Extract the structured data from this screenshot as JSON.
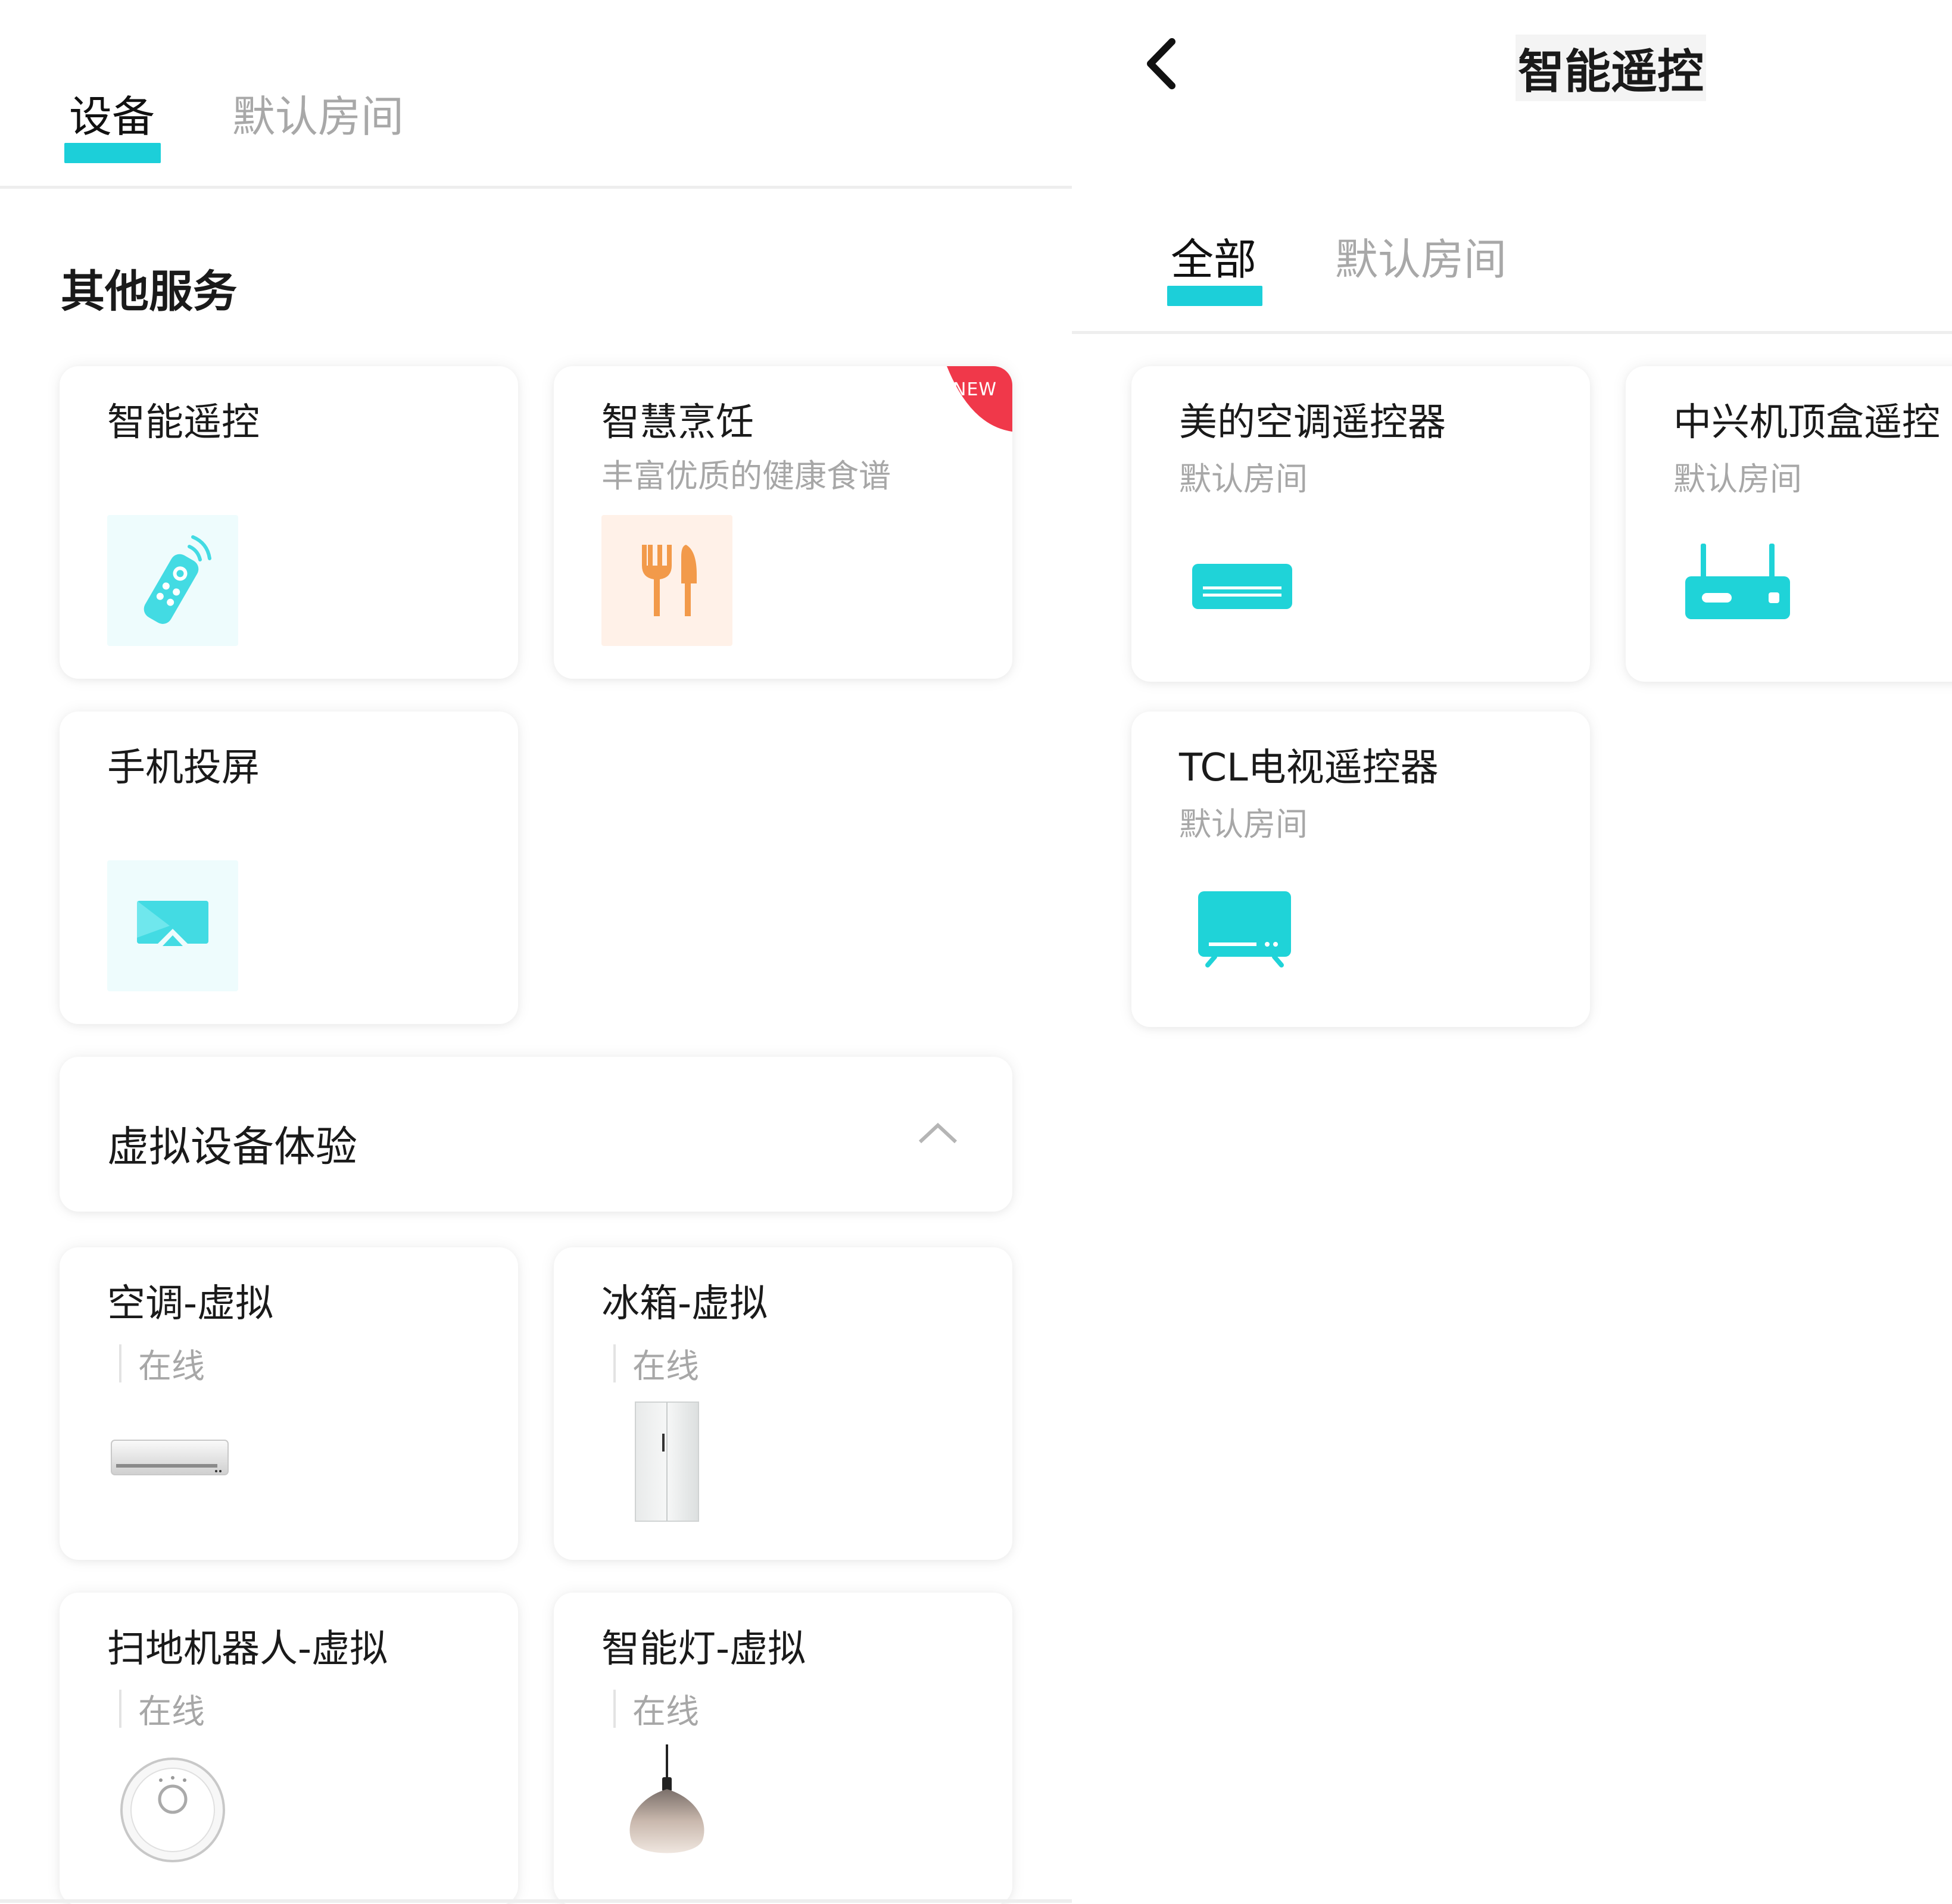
{
  "left": {
    "tabs": [
      {
        "label": "设备",
        "active": true
      },
      {
        "label": "默认房间",
        "active": false
      }
    ],
    "other_services": {
      "title": "其他服务",
      "cards": [
        {
          "title": "智能遥控",
          "icon": "remote-control-icon"
        },
        {
          "title": "智慧烹饪",
          "subtitle": "丰富优质的健康食谱",
          "badge": "NEW",
          "icon": "fork-knife-icon"
        },
        {
          "title": "手机投屏",
          "icon": "screen-cast-icon"
        }
      ]
    },
    "virtual": {
      "title": "虚拟设备体验",
      "toggle_icon": "chevron-up-icon",
      "devices": [
        {
          "title": "空调-虚拟",
          "status": "在线",
          "icon": "air-conditioner-image"
        },
        {
          "title": "冰箱-虚拟",
          "status": "在线",
          "icon": "refrigerator-image"
        },
        {
          "title": "扫地机器人-虚拟",
          "status": "在线",
          "icon": "robot-vacuum-image"
        },
        {
          "title": "智能灯-虚拟",
          "status": "在线",
          "icon": "pendant-lamp-image"
        }
      ]
    }
  },
  "right": {
    "header": {
      "title": "智能遥控",
      "back_icon": "chevron-left-icon"
    },
    "tabs": [
      {
        "label": "全部",
        "active": true
      },
      {
        "label": "默认房间",
        "active": false
      }
    ],
    "remotes": [
      {
        "title": "美的空调遥控器",
        "room": "默认房间",
        "icon": "air-conditioner-icon"
      },
      {
        "title": "中兴机顶盒遥控",
        "room": "默认房间",
        "icon": "set-top-box-icon"
      },
      {
        "title": "TCL电视遥控器",
        "room": "默认房间",
        "icon": "tv-icon"
      }
    ]
  },
  "colors": {
    "accent": "#1ccfd9",
    "badge": "#f0384a",
    "muted": "#a7a7a7"
  }
}
